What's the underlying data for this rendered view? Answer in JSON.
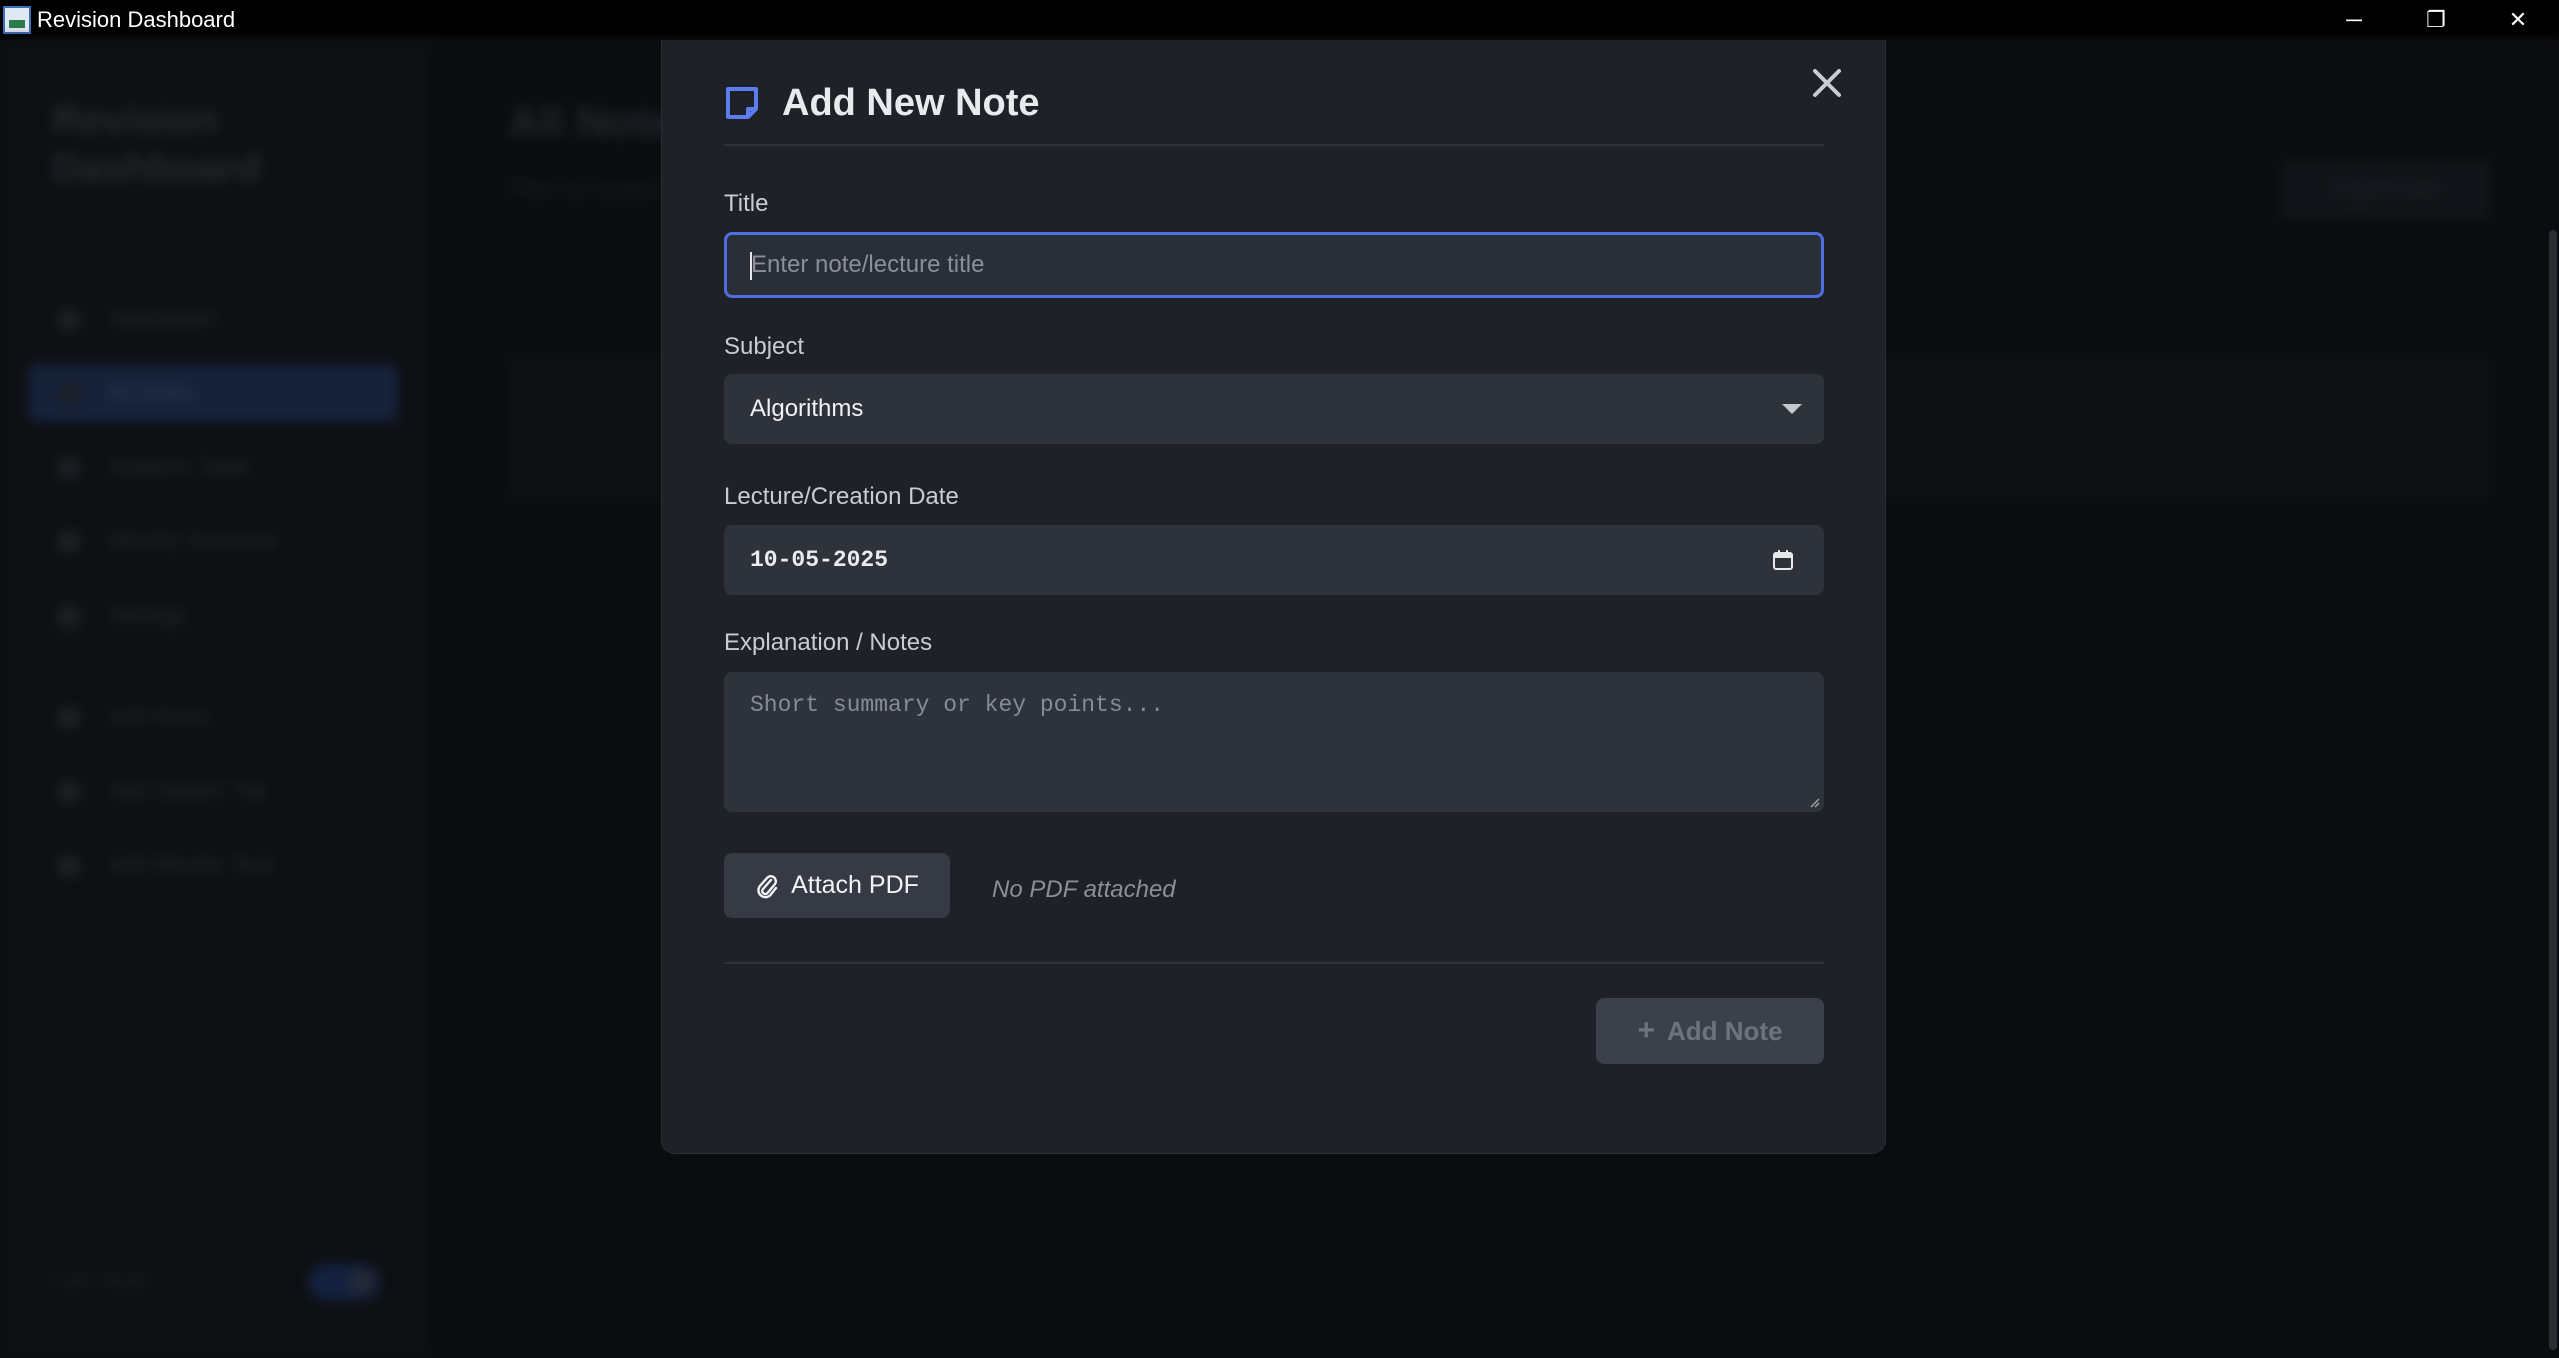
{
  "window": {
    "title": "Revision Dashboard",
    "controls": {
      "minimize": "─",
      "restore": "❐",
      "close": "✕"
    }
  },
  "background": {
    "brand": "Revision Dashboard",
    "nav": [
      "Dashboard",
      "All Notes",
      "Subjects Table",
      "Weekly Schedule",
      "Settings",
      "Add Notes",
      "Add Subject Tab",
      "Add Weekly Task"
    ],
    "active_nav_index": 1,
    "main_title": "All Notes",
    "main_subtitle": "Filter by Subject",
    "main_button": "Export Data",
    "toggle_label": "Dark Mode"
  },
  "modal": {
    "title": "Add New Note",
    "close_icon": "close-icon",
    "title_label": "Title",
    "title_placeholder": "Enter note/lecture title",
    "title_value": "",
    "subject_label": "Subject",
    "subject_value": "Algorithms",
    "date_label": "Lecture/Creation Date",
    "date_value": "10-05-2025",
    "notes_label": "Explanation / Notes",
    "notes_placeholder": "Short summary or key points...",
    "attach_label": "Attach PDF",
    "attach_status": "No PDF attached",
    "submit_label": "Add Note",
    "submit_disabled": true
  },
  "colors": {
    "accent": "#4f6fe0",
    "modal_bg": "#1e2127",
    "field_bg": "#2e323b",
    "note_icon": "#5b7df0"
  }
}
